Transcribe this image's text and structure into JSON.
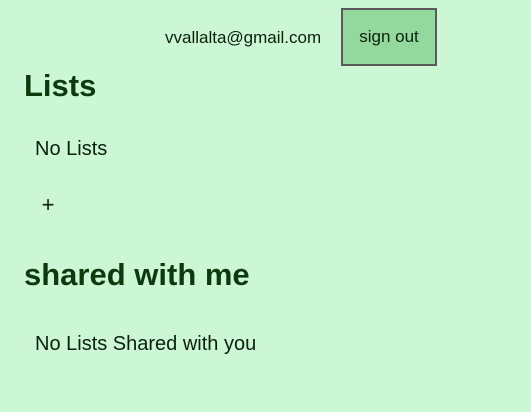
{
  "header": {
    "user_email": "vvallalta@gmail.com",
    "sign_out_label": "sign out"
  },
  "lists_section": {
    "title": "Lists",
    "empty_text": "No Lists",
    "add_button_label": "+"
  },
  "shared_section": {
    "title": "shared with me",
    "empty_text": "No Lists Shared with you"
  },
  "colors": {
    "background": "#cbf7d4",
    "button_background": "#93d99e",
    "heading": "#0b3a0f"
  }
}
